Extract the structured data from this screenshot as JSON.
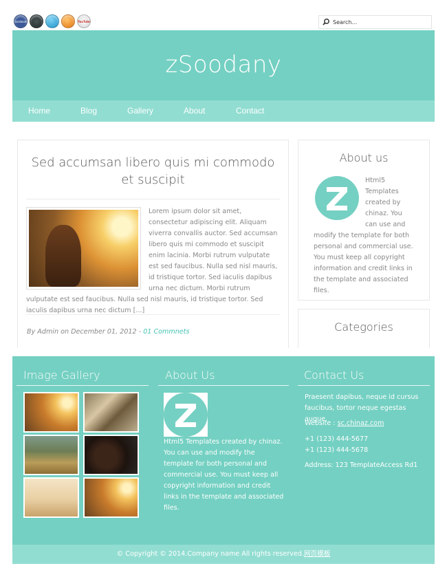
{
  "social": [
    {
      "name": "facebook",
      "label": "facebook",
      "color": "#3b5998"
    },
    {
      "name": "google",
      "label": "",
      "color": "#2f3a3b"
    },
    {
      "name": "twitter",
      "label": "",
      "color": "#29a9e1"
    },
    {
      "name": "rss",
      "label": "",
      "color": "#f28a1c"
    },
    {
      "name": "youtube",
      "label": "YouTube",
      "color": "#e9e9e9"
    }
  ],
  "search": {
    "placeholder": "Search..."
  },
  "site": {
    "title": "zSoodany"
  },
  "nav": [
    "Home",
    "Blog",
    "Gallery",
    "About",
    "Contact"
  ],
  "post": {
    "title": "Sed accumsan libero quis mi commodo et suscipit",
    "body": "Lorem ipsum dolor sit amet, consectetur adipiscing elit. Aliquam viverra convallis auctor. Sed accumsan libero quis mi commodo et suscipit enim lacinia. Morbi rutrum vulputate est sed faucibus. Nulla sed nisl mauris, id tristique tortor. Sed iaculis dapibus urna nec dictum. Morbi rutrum vulputate est sed faucibus. Nulla sed nisl mauris, id tristique tortor. Sed iaculis dapibus urna nec dictum [...]",
    "meta": "By Admin on December 01, 2012 - ",
    "comments": "01 Commnets"
  },
  "sidebar": {
    "about_title": "About us",
    "about_text": "Html5 Templates created by chinaz. You can use and modify the template for both personal and commercial use. You must keep all copyright information and credit links in the template and associated files.",
    "categories_title": "Categories",
    "logo_letter": "Z"
  },
  "footer": {
    "gallery_title": "Image Gallery",
    "about_title": "About Us",
    "about_text": "Html5 Templates created by chinaz. You can use and modify the template for both personal and commercial use. You must keep all copyright information and credit links in the template and associated files.",
    "contact_title": "Contact Us",
    "contact_intro": "Praesent dapibus, neque id cursus faucibus, tortor neque egestas augue.",
    "website_label": "Website : ",
    "website_link": "sc.chinaz.com",
    "phone1": "+1 (123) 444-5677",
    "phone2": "+1 (123) 444-5678",
    "address": "Address: 123 TemplateAccess Rd1",
    "copyright": "© Copyright © 2014.Company name All rights reserved.",
    "copyright_link": "网页模板"
  },
  "colors": {
    "accent": "#74d0c2",
    "nav": "#92ddd1",
    "link": "#45c2b3"
  }
}
